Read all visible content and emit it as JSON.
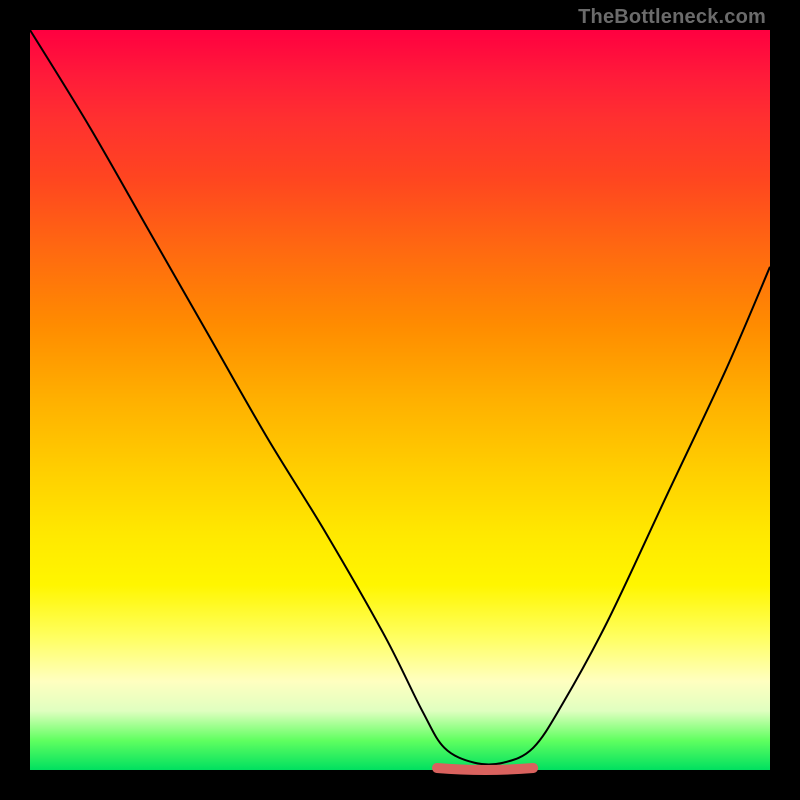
{
  "watermark": "TheBottleneck.com",
  "chart_data": {
    "type": "line",
    "title": "",
    "xlabel": "",
    "ylabel": "",
    "xlim": [
      0,
      100
    ],
    "ylim": [
      0,
      100
    ],
    "series": [
      {
        "name": "bottleneck-curve",
        "x": [
          0,
          8,
          16,
          24,
          32,
          40,
          48,
          53,
          56,
          60,
          64,
          68,
          72,
          78,
          86,
          94,
          100
        ],
        "values": [
          100,
          87,
          73,
          59,
          45,
          32,
          18,
          8,
          3,
          1,
          1,
          3,
          9,
          20,
          37,
          54,
          68
        ]
      }
    ],
    "annotations": [
      {
        "name": "valley-marker",
        "x_range": [
          55,
          68
        ],
        "y": 0,
        "color": "#d9625e"
      }
    ],
    "colors": {
      "curve": "#000000",
      "valley_marker": "#d9625e",
      "gradient_top": "#ff0040",
      "gradient_bottom": "#00e060",
      "frame": "#000000"
    }
  }
}
